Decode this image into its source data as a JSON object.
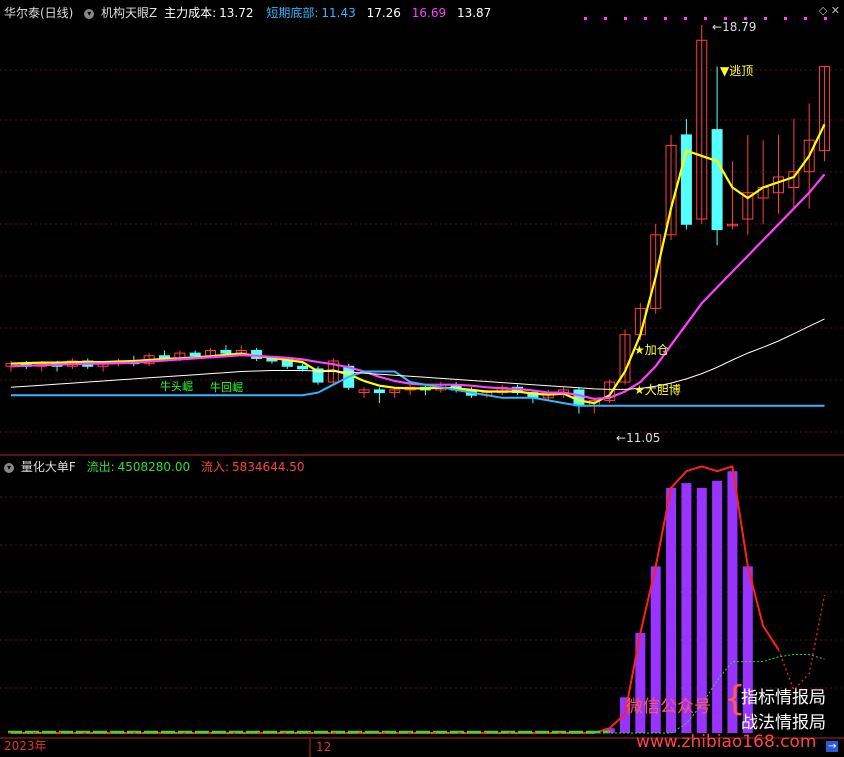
{
  "main_panel": {
    "stock": "华尔泰(日线)",
    "indicator": "机构天眼Z",
    "cost_label": "主力成本:",
    "cost_value": "13.72",
    "bottom_label": "短期底部:",
    "bottom_value": "11.43",
    "value_a": "17.26",
    "value_b": "16.69",
    "value_c": "13.87",
    "high_label": "18.79",
    "low_label": "11.05",
    "signal_escape": "▼逃顶",
    "signal_add": "★加仓",
    "signal_bet": "★大胆博",
    "signal_green_1": "牛头崛",
    "signal_green_2": "牛回崛"
  },
  "sub_panel": {
    "indicator": "量化大单F",
    "out_label": "流出:",
    "out_value": "4508280.00",
    "in_label": "流入:",
    "in_value": "5834644.50"
  },
  "x_axis": {
    "label_start": "2023年",
    "label_mid": "12"
  },
  "watermark": {
    "wechat": "微信公众号",
    "line1": "指标情报局",
    "line2": "战法情报局",
    "url": "www.zhibiao168.com"
  },
  "colors": {
    "up": "#ff4040",
    "down": "#54ffff",
    "yellow_line": "#ffff00",
    "magenta_line": "#ff40ff",
    "white_line": "#ffffff",
    "blue_line": "#33b5ff",
    "bar_purple": "#9933ff",
    "flow_red": "#ff2020",
    "flow_green": "#33dd33"
  },
  "chart_data": {
    "type": "candlestick",
    "candles": [
      [
        12.3,
        12.35,
        12.2,
        12.4
      ],
      [
        12.35,
        12.3,
        12.25,
        12.4
      ],
      [
        12.3,
        12.35,
        12.2,
        12.4
      ],
      [
        12.35,
        12.3,
        12.2,
        12.4
      ],
      [
        12.3,
        12.4,
        12.25,
        12.45
      ],
      [
        12.4,
        12.3,
        12.25,
        12.45
      ],
      [
        12.3,
        12.35,
        12.2,
        12.4
      ],
      [
        12.35,
        12.4,
        12.3,
        12.45
      ],
      [
        12.4,
        12.35,
        12.3,
        12.5
      ],
      [
        12.35,
        12.5,
        12.3,
        12.55
      ],
      [
        12.5,
        12.45,
        12.4,
        12.6
      ],
      [
        12.45,
        12.55,
        12.4,
        12.6
      ],
      [
        12.55,
        12.5,
        12.45,
        12.6
      ],
      [
        12.5,
        12.6,
        12.45,
        12.65
      ],
      [
        12.6,
        12.55,
        12.5,
        12.7
      ],
      [
        12.55,
        12.6,
        12.5,
        12.7
      ],
      [
        12.6,
        12.45,
        12.4,
        12.65
      ],
      [
        12.45,
        12.4,
        12.35,
        12.5
      ],
      [
        12.4,
        12.3,
        12.25,
        12.45
      ],
      [
        12.3,
        12.25,
        12.2,
        12.35
      ],
      [
        12.25,
        12.0,
        11.95,
        12.3
      ],
      [
        12.0,
        12.4,
        11.95,
        12.45
      ],
      [
        12.3,
        11.9,
        11.85,
        12.35
      ],
      [
        11.8,
        11.85,
        11.7,
        11.9
      ],
      [
        11.85,
        11.8,
        11.6,
        11.9
      ],
      [
        11.8,
        11.85,
        11.7,
        11.9
      ],
      [
        11.85,
        11.9,
        11.75,
        11.95
      ],
      [
        11.9,
        11.85,
        11.75,
        11.95
      ],
      [
        11.85,
        11.95,
        11.8,
        12.0
      ],
      [
        11.95,
        11.85,
        11.8,
        12.0
      ],
      [
        11.85,
        11.75,
        11.7,
        11.9
      ],
      [
        11.75,
        11.8,
        11.7,
        11.85
      ],
      [
        11.8,
        11.9,
        11.75,
        11.95
      ],
      [
        11.9,
        11.8,
        11.75,
        11.95
      ],
      [
        11.8,
        11.7,
        11.6,
        11.85
      ],
      [
        11.7,
        11.8,
        11.65,
        11.85
      ],
      [
        11.8,
        11.85,
        11.7,
        11.9
      ],
      [
        11.85,
        11.55,
        11.4,
        11.9
      ],
      [
        11.55,
        11.65,
        11.4,
        11.7
      ],
      [
        11.65,
        12.0,
        11.6,
        12.05
      ],
      [
        12.0,
        12.9,
        11.95,
        13.0
      ],
      [
        12.9,
        13.4,
        12.8,
        13.5
      ],
      [
        13.4,
        14.8,
        13.3,
        15.0
      ],
      [
        14.8,
        16.5,
        14.7,
        16.7
      ],
      [
        16.7,
        15.0,
        14.9,
        17.0
      ],
      [
        15.1,
        18.5,
        15.0,
        18.79
      ],
      [
        16.8,
        14.9,
        14.6,
        18.0
      ],
      [
        15.0,
        15.0,
        14.9,
        16.2
      ],
      [
        15.1,
        15.6,
        14.8,
        16.7
      ],
      [
        15.5,
        15.7,
        15.0,
        16.6
      ],
      [
        15.6,
        15.9,
        15.2,
        16.7
      ],
      [
        15.7,
        16.0,
        15.3,
        17.0
      ],
      [
        16.0,
        16.6,
        15.3,
        17.3
      ],
      [
        16.4,
        18.0,
        16.2,
        18.0
      ]
    ],
    "series": [
      {
        "name": "机构天眼Z",
        "values": [
          12.35,
          12.36,
          12.37,
          12.37,
          12.38,
          12.38,
          12.38,
          12.39,
          12.4,
          12.42,
          12.44,
          12.45,
          12.47,
          12.49,
          12.52,
          12.54,
          12.5,
          12.46,
          12.42,
          12.38,
          12.2,
          12.22,
          12.15,
          12.02,
          11.93,
          11.89,
          11.88,
          11.88,
          11.89,
          11.88,
          11.85,
          11.82,
          11.82,
          11.82,
          11.78,
          11.76,
          11.78,
          11.65,
          11.6,
          11.75,
          12.2,
          12.9,
          14.0,
          15.3,
          16.4,
          16.3,
          16.2,
          15.7,
          15.5,
          15.7,
          15.8,
          15.9,
          16.3,
          16.9
        ]
      },
      {
        "name": "主力成本",
        "values": [
          12.3,
          12.31,
          12.32,
          12.33,
          12.34,
          12.35,
          12.35,
          12.36,
          12.37,
          12.39,
          12.41,
          12.43,
          12.45,
          12.47,
          12.49,
          12.51,
          12.5,
          12.48,
          12.46,
          12.43,
          12.38,
          12.34,
          12.28,
          12.2,
          12.1,
          12.02,
          11.97,
          11.95,
          11.95,
          11.95,
          11.93,
          11.9,
          11.88,
          11.87,
          11.84,
          11.8,
          11.8,
          11.75,
          11.68,
          11.7,
          11.82,
          12.0,
          12.3,
          12.7,
          13.1,
          13.5,
          13.8,
          14.1,
          14.4,
          14.7,
          15.0,
          15.3,
          15.6,
          15.95
        ]
      },
      {
        "name": "短期底部",
        "values": [
          11.75,
          11.75,
          11.75,
          11.75,
          11.75,
          11.75,
          11.75,
          11.75,
          11.75,
          11.75,
          11.75,
          11.75,
          11.75,
          11.75,
          11.75,
          11.75,
          11.75,
          11.75,
          11.75,
          11.75,
          11.8,
          11.95,
          12.1,
          12.2,
          12.2,
          12.2,
          12.0,
          11.95,
          11.9,
          11.85,
          11.8,
          11.75,
          11.7,
          11.7,
          11.7,
          11.65,
          11.6,
          11.55,
          11.55,
          11.55,
          11.55,
          11.55,
          11.55,
          11.55,
          11.55,
          11.55,
          11.55,
          11.55,
          11.55,
          11.55,
          11.55,
          11.55,
          11.55,
          11.55
        ]
      },
      {
        "name": "长期均线",
        "values": [
          11.9,
          11.92,
          11.94,
          11.96,
          11.98,
          12.0,
          12.02,
          12.04,
          12.06,
          12.08,
          12.1,
          12.12,
          12.14,
          12.16,
          12.18,
          12.2,
          12.21,
          12.22,
          12.22,
          12.22,
          12.21,
          12.2,
          12.19,
          12.17,
          12.15,
          12.13,
          12.11,
          12.09,
          12.07,
          12.05,
          12.03,
          12.01,
          11.99,
          11.97,
          11.95,
          11.93,
          11.91,
          11.89,
          11.87,
          11.86,
          11.86,
          11.88,
          11.92,
          11.98,
          12.06,
          12.16,
          12.28,
          12.42,
          12.55,
          12.66,
          12.78,
          12.92,
          13.06,
          13.2
        ]
      },
      {
        "name": "大单柱",
        "values": [
          0,
          0,
          0,
          0,
          0,
          0,
          0,
          0,
          0,
          0,
          0,
          0,
          0,
          0,
          0,
          0,
          0,
          0,
          0,
          0,
          0,
          0,
          0,
          0,
          0,
          0,
          0,
          0,
          0,
          0,
          0,
          0,
          0,
          0,
          0,
          0,
          0,
          0,
          0,
          2,
          15,
          42,
          70,
          103,
          105,
          103,
          106,
          110,
          70,
          0,
          0,
          0,
          0,
          0
        ]
      }
    ],
    "flow_in": [
      0,
      0,
      0,
      0,
      0,
      0,
      0,
      0,
      0,
      0,
      0,
      0,
      0,
      0,
      0,
      0,
      0,
      0,
      0,
      0,
      0,
      0,
      0,
      0,
      0,
      0,
      0,
      0,
      0,
      0,
      0,
      0,
      0,
      0,
      0,
      0,
      0,
      0,
      0,
      2,
      8,
      42,
      70,
      103,
      110,
      112,
      110,
      112,
      70,
      45,
      35,
      18,
      25,
      58
    ],
    "flow_out": [
      0,
      0,
      0,
      0,
      0,
      0,
      0,
      0,
      0,
      0,
      0,
      0,
      0,
      0,
      0,
      0,
      0,
      0,
      0,
      0,
      0,
      0,
      0,
      0,
      0,
      0,
      0,
      0,
      0,
      0,
      0,
      0,
      0,
      0,
      0,
      0,
      0,
      0,
      0,
      0,
      0,
      0,
      0,
      0,
      4,
      12,
      22,
      30,
      30,
      30,
      32,
      33,
      33,
      31
    ]
  }
}
